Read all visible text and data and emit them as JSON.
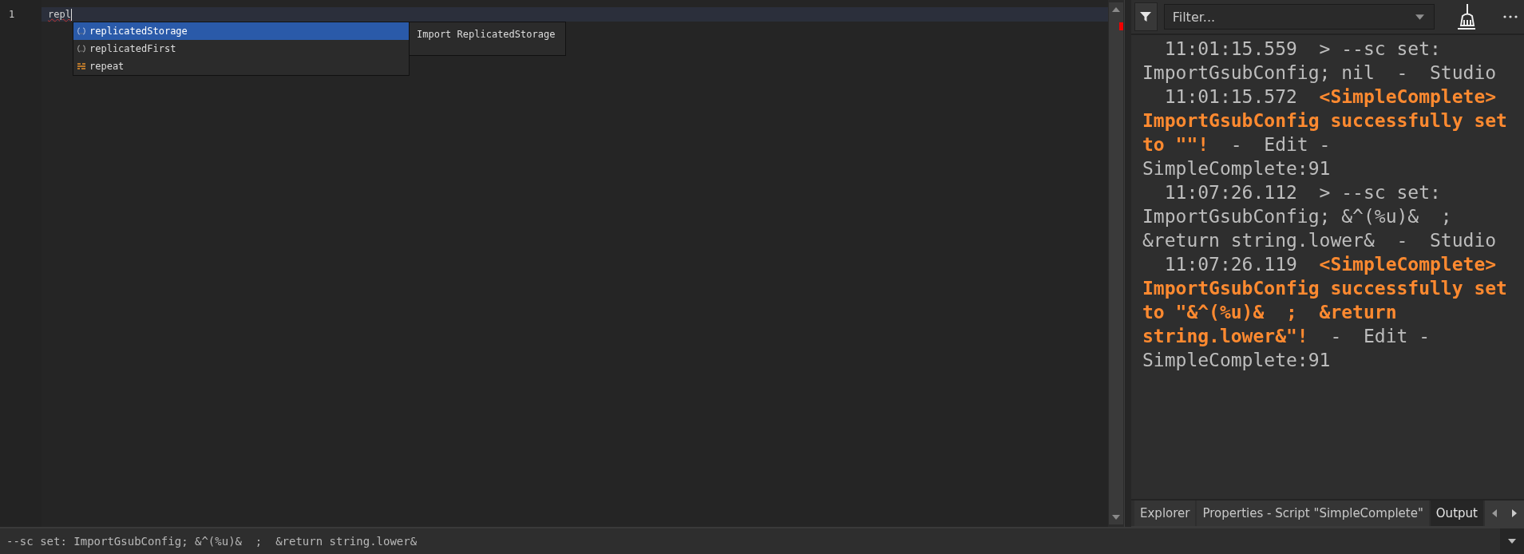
{
  "editor": {
    "line_numbers": [
      "1"
    ],
    "code": "repl",
    "autocomplete": {
      "items": [
        {
          "label": "replicatedStorage",
          "kind": "service",
          "selected": true
        },
        {
          "label": "replicatedFirst",
          "kind": "service",
          "selected": false
        },
        {
          "label": "repeat",
          "kind": "keyword",
          "selected": false
        }
      ],
      "detail": "Import ReplicatedStorage"
    }
  },
  "output": {
    "filter": {
      "placeholder": "Filter..."
    },
    "entries": [
      {
        "time": "11:01:15.559",
        "message": "> --sc set: ImportGsubConfig; nil",
        "highlighted": false,
        "source": "-  Studio"
      },
      {
        "time": "11:01:15.572",
        "message": "<SimpleComplete> ImportGsubConfig successfully set to \"\"!",
        "highlighted": true,
        "source": "-  Edit - SimpleComplete:91"
      },
      {
        "time": "11:07:26.112",
        "message": "> --sc set: ImportGsubConfig; &^(%u)&  ;  &return string.lower&",
        "highlighted": false,
        "source": "-  Studio"
      },
      {
        "time": "11:07:26.119",
        "message": "<SimpleComplete> ImportGsubConfig successfully set to \"&^(%u)&  ;  &return string.lower&\"!",
        "highlighted": true,
        "source": "-  Edit - SimpleComplete:91"
      }
    ]
  },
  "tabs": [
    {
      "label": "Explorer",
      "selected": false
    },
    {
      "label": "Properties - Script \"SimpleComplete\"",
      "selected": false
    },
    {
      "label": "Output",
      "selected": true
    }
  ],
  "command_bar": {
    "value": "--sc set: ImportGsubConfig; &^(%u)&  ;  &return string.lower&"
  }
}
